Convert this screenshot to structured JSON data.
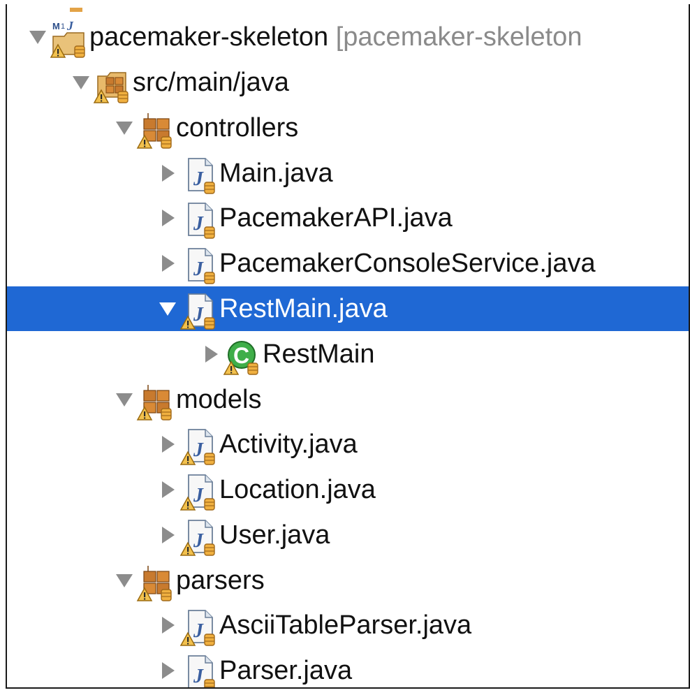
{
  "tree": {
    "selected_color": "#1f68d4",
    "rows": [
      {
        "label": "pacemaker-skeleton",
        "decoration": " [pacemaker-skeleton",
        "icon": "maven-java-project-icon",
        "expanded": true,
        "depth": 0
      },
      {
        "label": "src/main/java",
        "icon": "source-folder-icon",
        "expanded": true,
        "depth": 1
      },
      {
        "label": "controllers",
        "icon": "package-icon",
        "expanded": true,
        "depth": 2
      },
      {
        "label": "Main.java",
        "icon": "java-file-icon",
        "expanded": false,
        "depth": 3
      },
      {
        "label": "PacemakerAPI.java",
        "icon": "java-file-icon",
        "expanded": false,
        "depth": 3
      },
      {
        "label": "PacemakerConsoleService.java",
        "icon": "java-file-icon",
        "expanded": false,
        "depth": 3
      },
      {
        "label": "RestMain.java",
        "icon": "java-file-warning-icon",
        "expanded": true,
        "depth": 3,
        "selected": true
      },
      {
        "label": "RestMain",
        "icon": "java-class-icon",
        "expanded": false,
        "depth": 4
      },
      {
        "label": "models",
        "icon": "package-icon",
        "expanded": true,
        "depth": 2
      },
      {
        "label": "Activity.java",
        "icon": "java-file-warning-icon",
        "expanded": false,
        "depth": 3
      },
      {
        "label": "Location.java",
        "icon": "java-file-warning-icon",
        "expanded": false,
        "depth": 3
      },
      {
        "label": "User.java",
        "icon": "java-file-warning-icon",
        "expanded": false,
        "depth": 3
      },
      {
        "label": "parsers",
        "icon": "package-icon",
        "expanded": true,
        "depth": 2
      },
      {
        "label": "AsciiTableParser.java",
        "icon": "java-file-warning-icon",
        "expanded": false,
        "depth": 3
      },
      {
        "label": "Parser.java",
        "icon": "java-file-icon",
        "expanded": false,
        "depth": 3
      }
    ]
  }
}
